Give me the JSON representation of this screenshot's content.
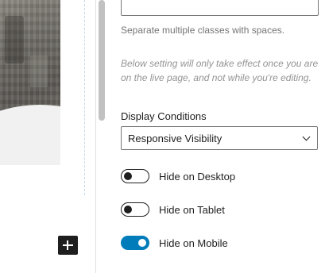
{
  "settings": {
    "css_class_input": {
      "value": "",
      "placeholder": ""
    },
    "css_class_help": "Separate multiple classes with spaces.",
    "live_page_note": "Below setting will only take effect once you are on the live page, and not while you're editing.",
    "display_conditions": {
      "label": "Display Conditions",
      "selected": "Responsive Visibility"
    },
    "toggles": [
      {
        "label": "Hide on Desktop",
        "on": false
      },
      {
        "label": "Hide on Tablet",
        "on": false
      },
      {
        "label": "Hide on Mobile",
        "on": true
      }
    ]
  },
  "colors": {
    "accent": "#007cba",
    "text": "#1e1e1e",
    "muted": "#757575"
  },
  "icons": {
    "add_block": "plus-icon",
    "select": "chevron-down-icon"
  }
}
